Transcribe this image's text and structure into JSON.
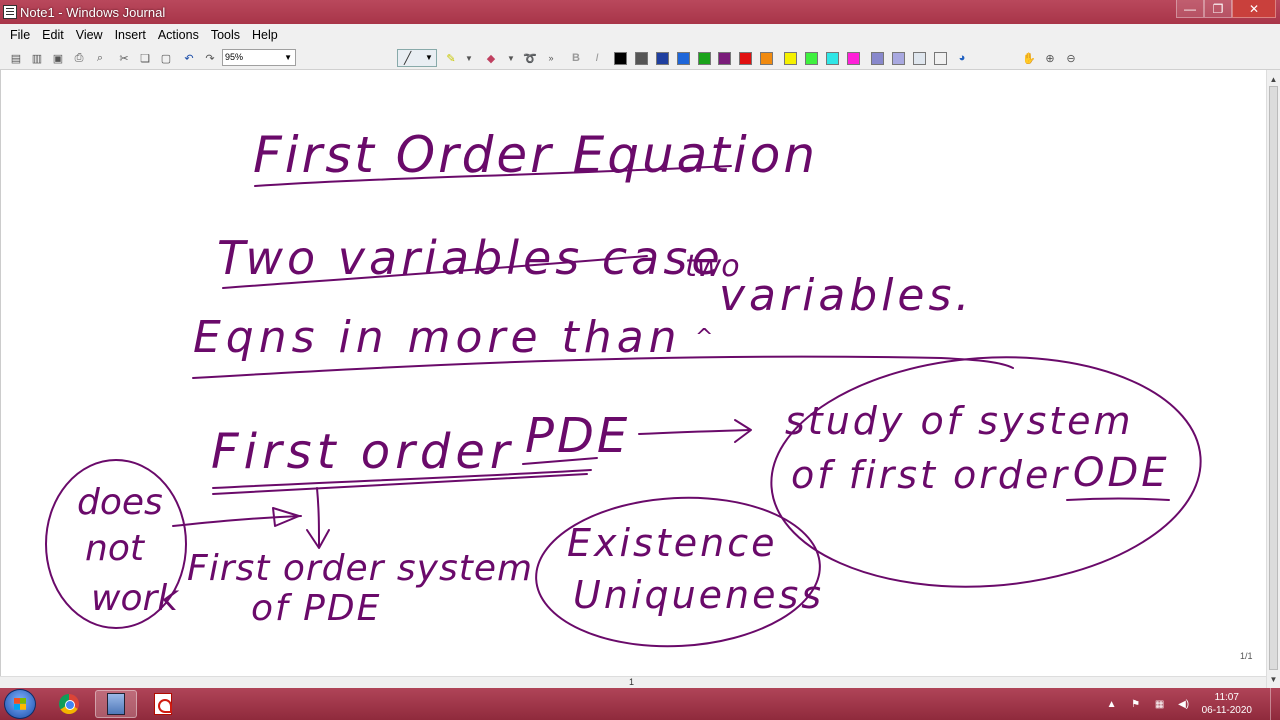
{
  "window": {
    "title": "Note1 - Windows Journal",
    "minimize_glyph": "—",
    "restore_glyph": "❐",
    "close_glyph": "✕"
  },
  "menu": {
    "items": [
      "File",
      "Edit",
      "View",
      "Insert",
      "Actions",
      "Tools",
      "Help"
    ]
  },
  "toolbar": {
    "zoom_value": "95%",
    "bold_label": "B",
    "italic_label": "I",
    "colors": [
      "#000000",
      "#555555",
      "#1f3f9f",
      "#1e66d9",
      "#1aa31a",
      "#7a1c7a",
      "#e01010",
      "#f08a10",
      "#f5f000",
      "#3ff03f",
      "#2fe6e6",
      "#ff20d8",
      "#8888cc",
      "#a8a8e0",
      "#dfe6ee",
      "#f0f0f0"
    ]
  },
  "page": {
    "ink_color": "#6a0a6a",
    "lines": {
      "title": "First Order Equation",
      "two_vars": "Two variables case",
      "more_than": "Eqns in more than",
      "caret": "^",
      "two": "two",
      "variables": "variables.",
      "first_order_pde": "First order",
      "pde": "PDE",
      "study_1": "study of system",
      "study_2": "of first order",
      "ode": "ODE",
      "does": "does",
      "not": "not",
      "work": "work",
      "system_1": "First order system",
      "system_2": "of PDE",
      "existence": "Existence",
      "uniqueness": "Uniqueness"
    },
    "page_indicator": "1/1",
    "page_number": "1"
  },
  "taskbar": {
    "time": "11:07",
    "date": "06-11-2020"
  }
}
